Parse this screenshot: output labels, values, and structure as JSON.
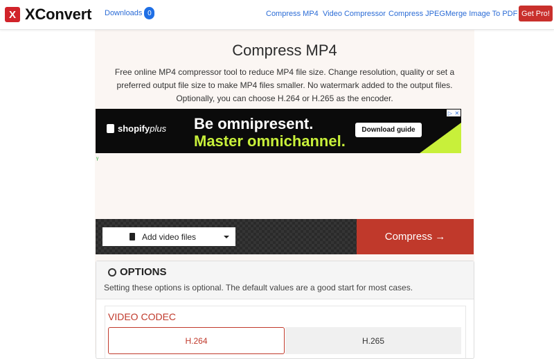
{
  "navbar": {
    "brand_logo": "X",
    "brand_name": "XConvert",
    "downloads_label": "Downloads",
    "downloads_count": "0",
    "links": [
      "Compress MP4",
      "Video Compressor",
      "Compress JPEG",
      "Merge Image To PDF"
    ],
    "cta": "Get Pro!"
  },
  "main": {
    "title": "Compress MP4",
    "description": "Free online MP4 compressor tool to reduce MP4 file size. Change resolution, quality or set a preferred output file size to make MP4 files smaller. No watermark added to the output files. Optionally, you can choose H.264 or H.265 as the encoder."
  },
  "ad": {
    "brand": "shopify",
    "brand_suffix": "plus",
    "line1": "Be omnipresent.",
    "line2": "Master omnichannel.",
    "button": "Download guide",
    "adchoices": "▷",
    "close": "✕",
    "marker": "ᵞ"
  },
  "toolbar": {
    "add_files": "Add video files",
    "compress": "Compress →"
  },
  "options": {
    "title": "OPTIONS",
    "subtitle": "Setting these options is optional. The default values are a good start for most cases.",
    "codec_label": "VIDEO CODEC",
    "codecs": [
      "H.264",
      "H.265"
    ],
    "selected_codec": "H.264"
  },
  "colors": {
    "accent_red": "#c0392b",
    "link_blue": "#2b6cd6",
    "ad_green": "#c8f03a",
    "panel_bg": "#fbf6f3"
  }
}
